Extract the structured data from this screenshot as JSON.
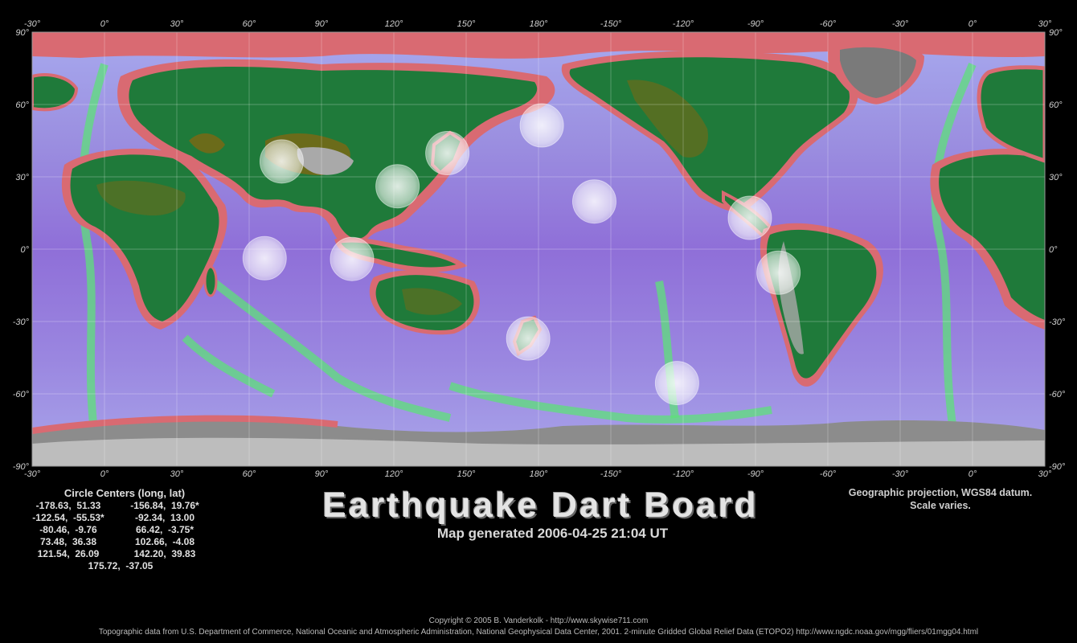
{
  "map": {
    "lon_labels": [
      "-30°",
      "0°",
      "30°",
      "60°",
      "90°",
      "120°",
      "150°",
      "180°",
      "-150°",
      "-120°",
      "-90°",
      "-60°",
      "-30°",
      "0°",
      "30°"
    ],
    "lat_labels": [
      "90°",
      "60°",
      "30°",
      "0°",
      "-30°",
      "-60°",
      "-90°"
    ],
    "circle_centers": [
      {
        "lon": -178.63,
        "lat": 51.33
      },
      {
        "lon": -156.84,
        "lat": 19.76
      },
      {
        "lon": -122.54,
        "lat": -55.53
      },
      {
        "lon": -92.34,
        "lat": 13.0
      },
      {
        "lon": -80.46,
        "lat": -9.76
      },
      {
        "lon": 66.42,
        "lat": -3.75
      },
      {
        "lon": 73.48,
        "lat": 36.38
      },
      {
        "lon": 102.66,
        "lat": -4.08
      },
      {
        "lon": 121.54,
        "lat": 26.09
      },
      {
        "lon": 142.2,
        "lat": 39.83
      },
      {
        "lon": 175.72,
        "lat": -37.05
      }
    ],
    "colors": {
      "ocean_deep": "#8a6ed8",
      "ocean_mid": "#9aa2ec",
      "shelf": "#66dd66",
      "coast": "#d96a72",
      "land_low": "#1f7a3a",
      "land_high": "#6b6b1a",
      "ice": "#cfcfcf",
      "circle": "#ffffff"
    }
  },
  "title": "Earthquake Dart Board",
  "generated": "Map generated 2006-04-25 21:04 UT",
  "centers_panel": {
    "heading": "Circle Centers (long, lat)",
    "rows": [
      [
        "-178.63,  51.33",
        "-156.84,  19.76*"
      ],
      [
        "-122.54,  -55.53*",
        "-92.34,  13.00"
      ],
      [
        "-80.46,  -9.76",
        "66.42,  -3.75*"
      ],
      [
        "73.48,  36.38",
        "102.66,  -4.08"
      ],
      [
        "121.54,  26.09",
        "142.20,  39.83"
      ]
    ],
    "last": "175.72,  -37.05"
  },
  "projection": {
    "line1": "Geographic projection, WGS84 datum.",
    "line2": "Scale varies."
  },
  "footer": {
    "copyright": "Copyright © 2005 B. Vanderkolk - http://www.skywise711.com",
    "source": "Topographic data from U.S. Department of Commerce, National Oceanic and Atmospheric Administration, National Geophysical Data Center, 2001. 2-minute Gridded Global Relief Data (ETOPO2) http://www.ngdc.noaa.gov/mgg/fliers/01mgg04.html"
  }
}
